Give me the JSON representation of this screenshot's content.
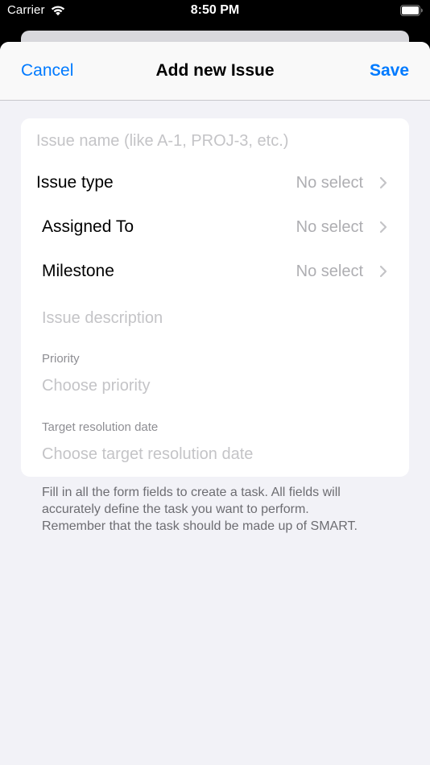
{
  "status_bar": {
    "carrier": "Carrier",
    "time": "8:50 PM"
  },
  "nav": {
    "cancel_label": "Cancel",
    "title": "Add new Issue",
    "save_label": "Save"
  },
  "form": {
    "issue_name_placeholder": "Issue name (like A-1, PROJ-3, etc.)",
    "issue_type": {
      "label": "Issue type",
      "value": "No select"
    },
    "assigned_to": {
      "label": "Assigned To",
      "value": "No select"
    },
    "milestone": {
      "label": "Milestone",
      "value": "No select"
    },
    "description_placeholder": "Issue description",
    "priority": {
      "label": "Priority",
      "placeholder": "Choose priority"
    },
    "target_date": {
      "label": "Target resolution date",
      "placeholder": "Choose target resolution date"
    }
  },
  "footer": {
    "lines": [
      "Fill in all the form fields to create a task. All fields will",
      "accurately define the task you want to perform.",
      "Remember that the task should be made up of SMART."
    ]
  },
  "colors": {
    "accent": "#007aff",
    "background": "#f2f2f7",
    "card": "#ffffff",
    "placeholder": "#c4c4c7",
    "secondary_text": "#aeaeb2"
  },
  "icons": [
    "wifi-icon",
    "battery-icon",
    "chevron-right-icon"
  ]
}
